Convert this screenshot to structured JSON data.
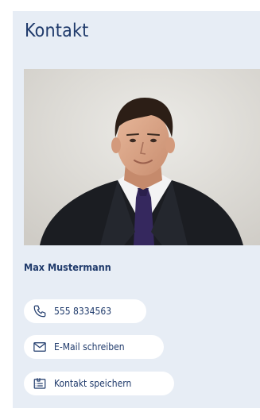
{
  "card": {
    "title": "Kontakt",
    "photo_alt": "Portrait of contact person",
    "name": "Max Mustermann"
  },
  "actions": {
    "phone": {
      "label": "555 8334563",
      "icon": "phone-icon"
    },
    "email": {
      "label": "E-Mail schreiben",
      "icon": "mail-icon"
    },
    "save": {
      "label": "Kontakt speichern",
      "icon": "contact-card-icon"
    }
  },
  "colors": {
    "card_background": "#e7edf5",
    "text_primary": "#1f3a6b",
    "pill_background": "#ffffff"
  }
}
